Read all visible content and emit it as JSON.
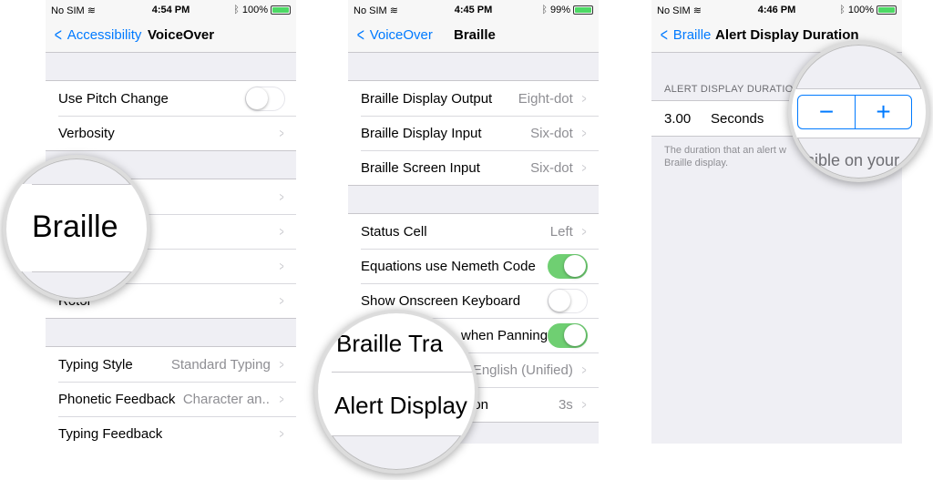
{
  "screen1": {
    "status": {
      "carrier": "No SIM",
      "time": "4:54 PM",
      "battery": "100%",
      "battery_level": 1.0
    },
    "nav": {
      "back": "Accessibility",
      "title": "VoiceOver"
    },
    "row_pitch": "Use Pitch Change",
    "row_verbosity": "Verbosity",
    "partial_row": "Rotor",
    "magnifier": "Braille",
    "rows_bottom": [
      {
        "label": "Typing Style",
        "value": "Standard Typing"
      },
      {
        "label": "Phonetic Feedback",
        "value": "Character an..."
      },
      {
        "label": "Typing Feedback",
        "value": ""
      }
    ],
    "pitch_toggle": false
  },
  "screen2": {
    "status": {
      "carrier": "No SIM",
      "time": "4:45 PM",
      "battery": "99%",
      "battery_level": 0.99
    },
    "nav": {
      "back": "VoiceOver",
      "title": "Braille"
    },
    "group1": [
      {
        "label": "Braille Display Output",
        "value": "Eight-dot"
      },
      {
        "label": "Braille Display Input",
        "value": "Six-dot"
      },
      {
        "label": "Braille Screen Input",
        "value": "Six-dot"
      }
    ],
    "group2": {
      "status_cell": {
        "label": "Status Cell",
        "value": "Left"
      },
      "nemeth": {
        "label": "Equations use Nemeth Code",
        "on": true
      },
      "onscreen": {
        "label": "Show Onscreen Keyboard",
        "on": false
      },
      "panning": {
        "label": "when Panning",
        "on": true
      },
      "translation_value": "English (Unified)",
      "duration": {
        "label": "ion",
        "value": "3s"
      }
    },
    "magnifier": {
      "line1": "Braille Tra",
      "line2": "Alert Display"
    }
  },
  "screen3": {
    "status": {
      "carrier": "No SIM",
      "time": "4:46 PM",
      "battery": "100%",
      "battery_level": 1.0
    },
    "nav": {
      "back": "Braille",
      "title": "Alert Display Duration"
    },
    "section_header": "ALERT DISPLAY DURATION",
    "value": "3.00",
    "unit": "Seconds",
    "footer_visible": "The duration that an alert w",
    "footer_line2": "Braille display.",
    "stepper": {
      "minus": "−",
      "plus": "+"
    },
    "magnifier_text": "sible on your"
  }
}
